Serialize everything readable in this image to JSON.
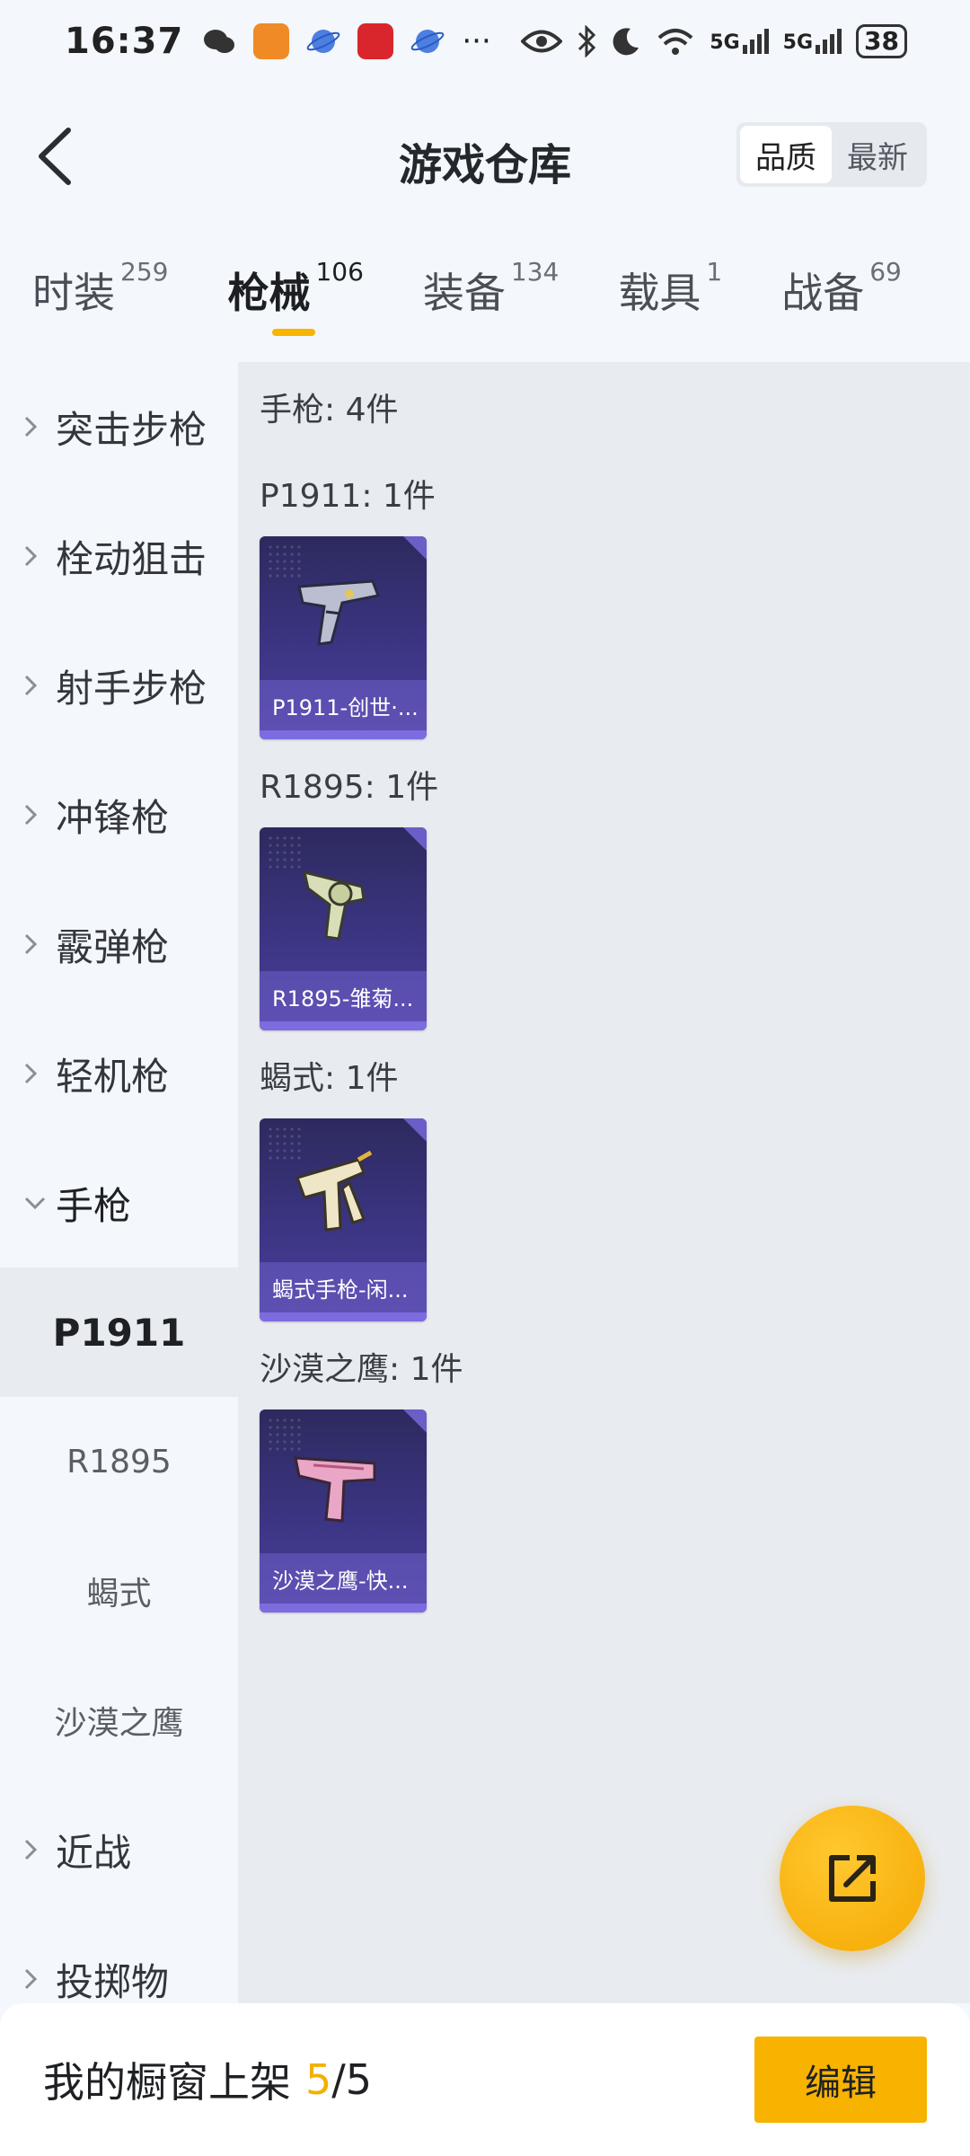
{
  "status": {
    "time": "16:37",
    "battery": "38",
    "net1": "5G",
    "net2": "5G"
  },
  "header": {
    "title": "游戏仓库",
    "sort_options": [
      "品质",
      "最新"
    ],
    "sort_selected": "品质"
  },
  "tabs": [
    {
      "label": "时装",
      "count": "259",
      "active": false
    },
    {
      "label": "枪械",
      "count": "106",
      "active": true
    },
    {
      "label": "装备",
      "count": "134",
      "active": false
    },
    {
      "label": "载具",
      "count": "1",
      "active": false
    },
    {
      "label": "战备",
      "count": "69",
      "active": false
    }
  ],
  "sidebar": {
    "categories": [
      {
        "label": "突击步枪"
      },
      {
        "label": "栓动狙击"
      },
      {
        "label": "射手步枪"
      },
      {
        "label": "冲锋枪"
      },
      {
        "label": "霰弹枪"
      },
      {
        "label": "轻机枪"
      },
      {
        "label": "手枪"
      }
    ],
    "subitems": [
      {
        "label": "P1911",
        "active": true
      },
      {
        "label": "R1895",
        "active": false
      },
      {
        "label": "蝎式",
        "active": false
      },
      {
        "label": "沙漠之鹰",
        "active": false
      }
    ],
    "after": [
      {
        "label": "近战"
      },
      {
        "label": "投掷物"
      }
    ]
  },
  "content": {
    "section_title": "手枪: 4件",
    "groups": [
      {
        "title": "P1911: 1件",
        "item_name": "P1911-创世·...",
        "gun_color": "#b9bfd0"
      },
      {
        "title": "R1895: 1件",
        "item_name": "R1895-雏菊...",
        "gun_color": "#d8dfb8"
      },
      {
        "title": "蝎式: 1件",
        "item_name": "蝎式手枪-闲...",
        "gun_color": "#efe6c8"
      },
      {
        "title": "沙漠之鹰: 1件",
        "item_name": "沙漠之鹰-快...",
        "gun_color": "#e9a6c6"
      }
    ]
  },
  "bottom": {
    "showcase_label": "我的橱窗上架",
    "showcase_count": "5",
    "showcase_sep": "/",
    "showcase_total": "5",
    "edit_label": "编辑"
  },
  "colors": {
    "accent": "#f7b300",
    "card_bg": "#3c3584"
  }
}
